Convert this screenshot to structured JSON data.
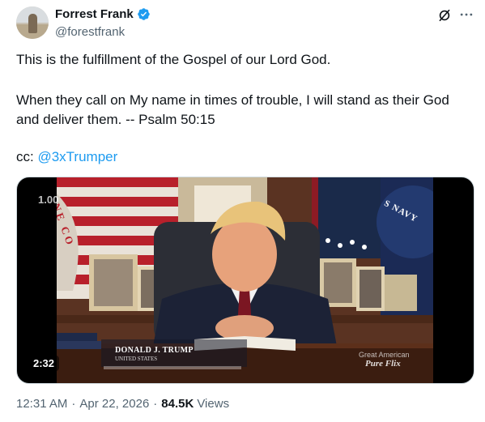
{
  "author": {
    "display_name": "Forrest Frank",
    "handle": "@forestfrank",
    "verified": true,
    "avatar_icon": "profile-photo"
  },
  "header_icons": {
    "grok": "grok-icon",
    "more": "more-icon"
  },
  "tweet": {
    "line1": "This is the fulfillment of the Gospel of our Lord God.",
    "line2a": "When they call on My name in times of trouble, I will stand as their God",
    "line2b": "and deliver them. -- Psalm 50:15",
    "cc_prefix": "cc: ",
    "mention": "@3xTrumper"
  },
  "video": {
    "speed_label": "1.00",
    "duration": "2:32",
    "lower_third_name": "DONALD J. TRUMP",
    "lower_third_title": "UNITED STATES",
    "watermark_line1": "Great American",
    "watermark_line2": "Pure Flix",
    "flag_text_left": "NE CO",
    "flag_text_right": "S NAVY"
  },
  "footer": {
    "time": "12:31 AM",
    "date": "Apr 22, 2026",
    "views_count": "84.5K",
    "views_label": "Views"
  },
  "colors": {
    "link": "#1d9bf0",
    "secondary": "#536471",
    "text": "#0f1419"
  }
}
